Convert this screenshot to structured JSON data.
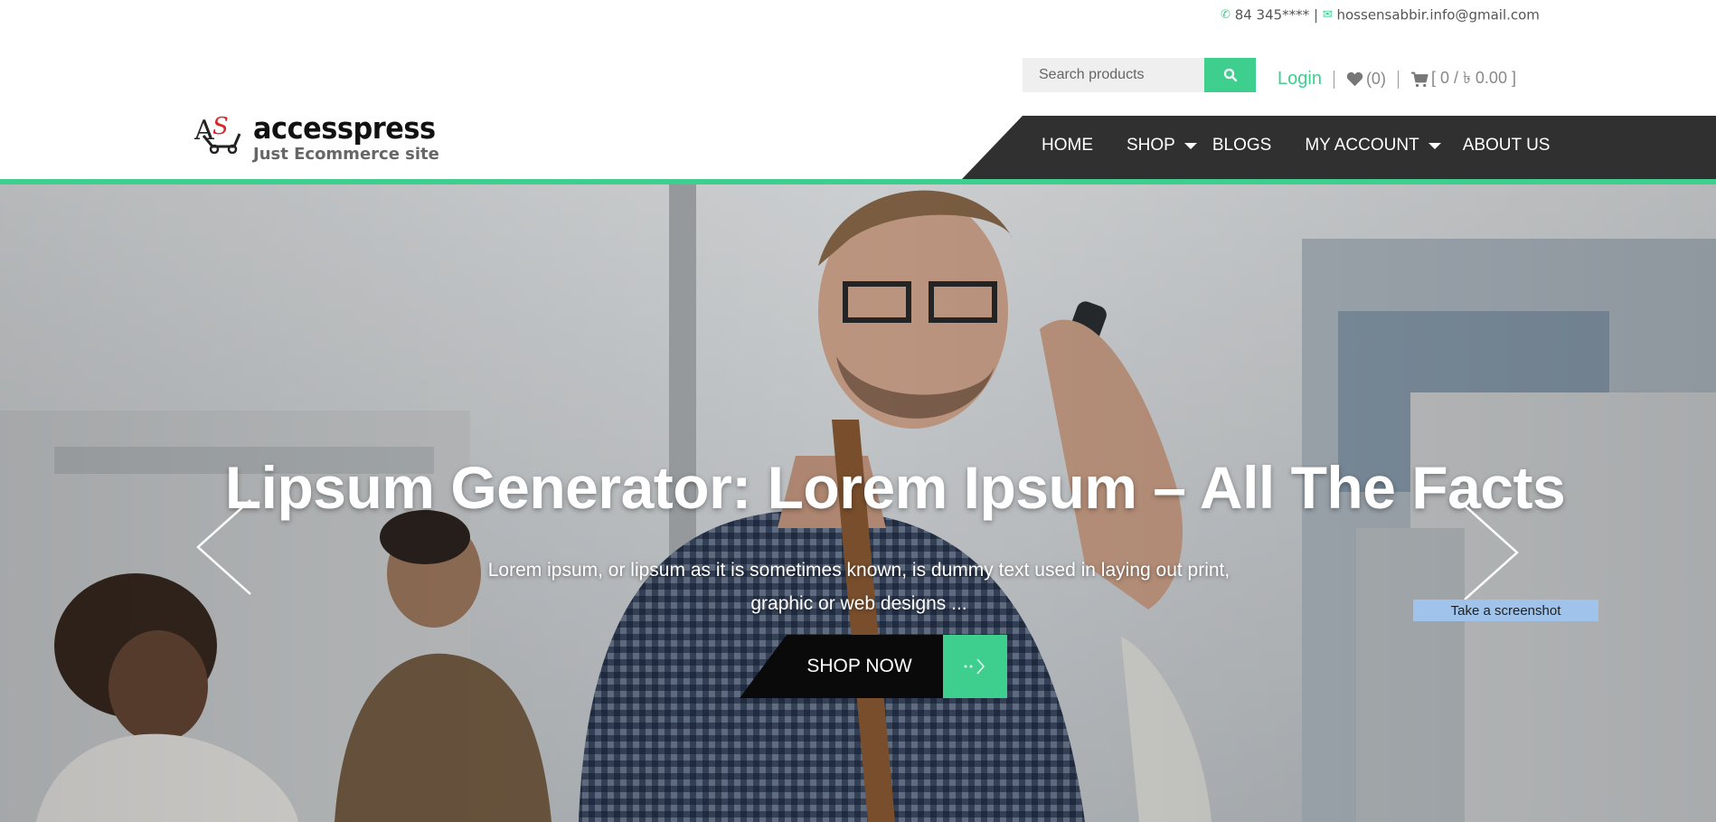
{
  "contact": {
    "phone": "84 345****",
    "separator": "|",
    "email": "hossensabbir.info@gmail.com"
  },
  "search": {
    "placeholder": "Search products"
  },
  "account": {
    "login": "Login",
    "wishlist_count": "(0)",
    "cart_summary": "[ 0 / ৳ 0.00 ]"
  },
  "brand": {
    "name": "accesspress",
    "tagline": "Just Ecommerce site"
  },
  "nav": {
    "items": [
      {
        "label": "HOME",
        "has_dropdown": false
      },
      {
        "label": "SHOP",
        "has_dropdown": true
      },
      {
        "label": "BLOGS",
        "has_dropdown": false
      },
      {
        "label": "MY ACCOUNT",
        "has_dropdown": true
      },
      {
        "label": "ABOUT US",
        "has_dropdown": false
      }
    ]
  },
  "hero": {
    "title": "Lipsum Generator: Lorem Ipsum – All The Facts",
    "description_line1": "Lorem ipsum, or lipsum as it is sometimes known, is dummy text used in laying out print,",
    "description_line2": "graphic or web designs ...",
    "button_label": "SHOP NOW"
  },
  "tooltip": {
    "label": "Take a screenshot"
  },
  "colors": {
    "accent": "#3ecf8e",
    "nav_bg": "#303030",
    "button_dark": "#0a0a0a",
    "tooltip_bg": "#9fc3ea"
  }
}
